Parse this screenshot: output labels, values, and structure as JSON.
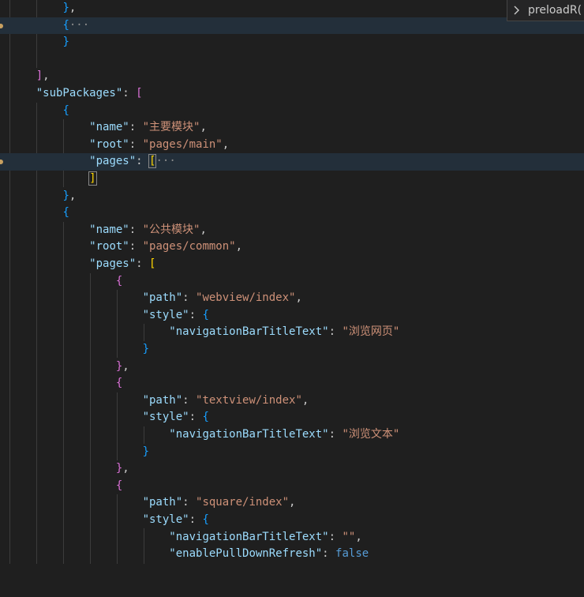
{
  "breadcrumb_widget": {
    "chevron_icon": "chevron-right-icon",
    "label": "preloadR("
  },
  "fold": {
    "ellipsis": "···"
  },
  "json": {
    "sub_packages_key": "\"subPackages\"",
    "name_key": "\"name\"",
    "root_key": "\"root\"",
    "pages_key": "\"pages\"",
    "path_key": "\"path\"",
    "style_key": "\"style\"",
    "nav_title_key": "\"navigationBarTitleText\"",
    "pull_refresh_key": "\"enablePullDownRefresh\"",
    "pkg_main_name": "\"主要模块\"",
    "pkg_main_root": "\"pages/main\"",
    "pkg_common_name": "\"公共模块\"",
    "pkg_common_root": "\"pages/common\"",
    "path_webview": "\"webview/index\"",
    "title_webview": "\"浏览网页\"",
    "path_textview": "\"textview/index\"",
    "title_textview": "\"浏览文本\"",
    "path_square": "\"square/index\"",
    "title_square": "\"\"",
    "pull_refresh_value": "false"
  },
  "colors": {
    "background": "#1f1f1f",
    "key": "#9cdcfe",
    "string": "#ce9178",
    "boolean": "#569cd6",
    "bracket_level1": "#da70d6",
    "bracket_level2": "#179fff",
    "bracket_level3": "#ffd700"
  }
}
